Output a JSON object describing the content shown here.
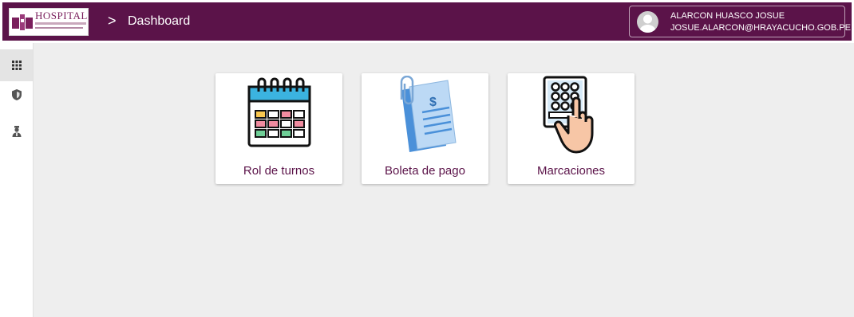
{
  "header": {
    "logo_text": "HOSPITAL",
    "breadcrumb_separator": ">",
    "page_title": "Dashboard",
    "user": {
      "name": "ALARCON HUASCO JOSUE",
      "email": "JOSUE.ALARCON@HRAYACUCHO.GOB.PE"
    },
    "bar_color": "#5b1349"
  },
  "sidebar": {
    "items": [
      {
        "icon": "apps-grid-icon",
        "active": true
      },
      {
        "icon": "shield-icon",
        "active": false
      },
      {
        "icon": "user-badge-icon",
        "active": false
      }
    ]
  },
  "cards": [
    {
      "label": "Rol de turnos",
      "icon": "calendar-icon"
    },
    {
      "label": "Boleta de pago",
      "icon": "payslip-icon"
    },
    {
      "label": "Marcaciones",
      "icon": "keypad-hand-icon"
    }
  ]
}
